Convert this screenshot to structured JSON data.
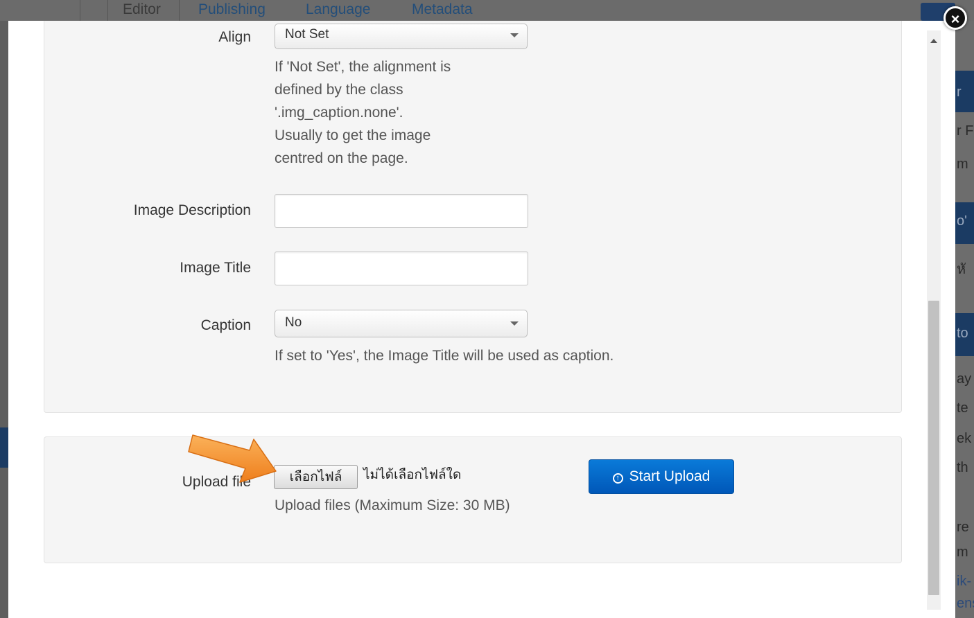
{
  "background": {
    "tabs": [
      "Editor",
      "Publishing",
      "Language",
      "Metadata"
    ],
    "right_fragments": [
      "r",
      "r F",
      "m",
      "o'",
      "หั",
      "to",
      "ay",
      "te",
      "ek",
      "th",
      "re",
      "m",
      "ik-",
      "ens"
    ]
  },
  "modal": {
    "close_icon": "×",
    "align": {
      "label": "Align",
      "value": "Not Set",
      "help": [
        "If 'Not Set', the alignment is",
        "defined by the class",
        "'.img_caption.none'.",
        "Usually to get the image",
        "centred on the page."
      ]
    },
    "image_description": {
      "label": "Image Description",
      "value": ""
    },
    "image_title": {
      "label": "Image Title",
      "value": ""
    },
    "caption": {
      "label": "Caption",
      "value": "No",
      "help": "If set to 'Yes', the Image Title will be used as caption."
    },
    "upload": {
      "label": "Upload file",
      "choose_file_button": "เลือกไฟล์",
      "no_file_text": "ไม่ได้เลือกไฟล์ใด",
      "help": "Upload files (Maximum Size: 30 MB)",
      "start_upload_button": "Start Upload",
      "start_upload_icon": "upload-circle-icon"
    }
  },
  "colors": {
    "accent": "#0066cc",
    "arrow": "#f5922a"
  }
}
